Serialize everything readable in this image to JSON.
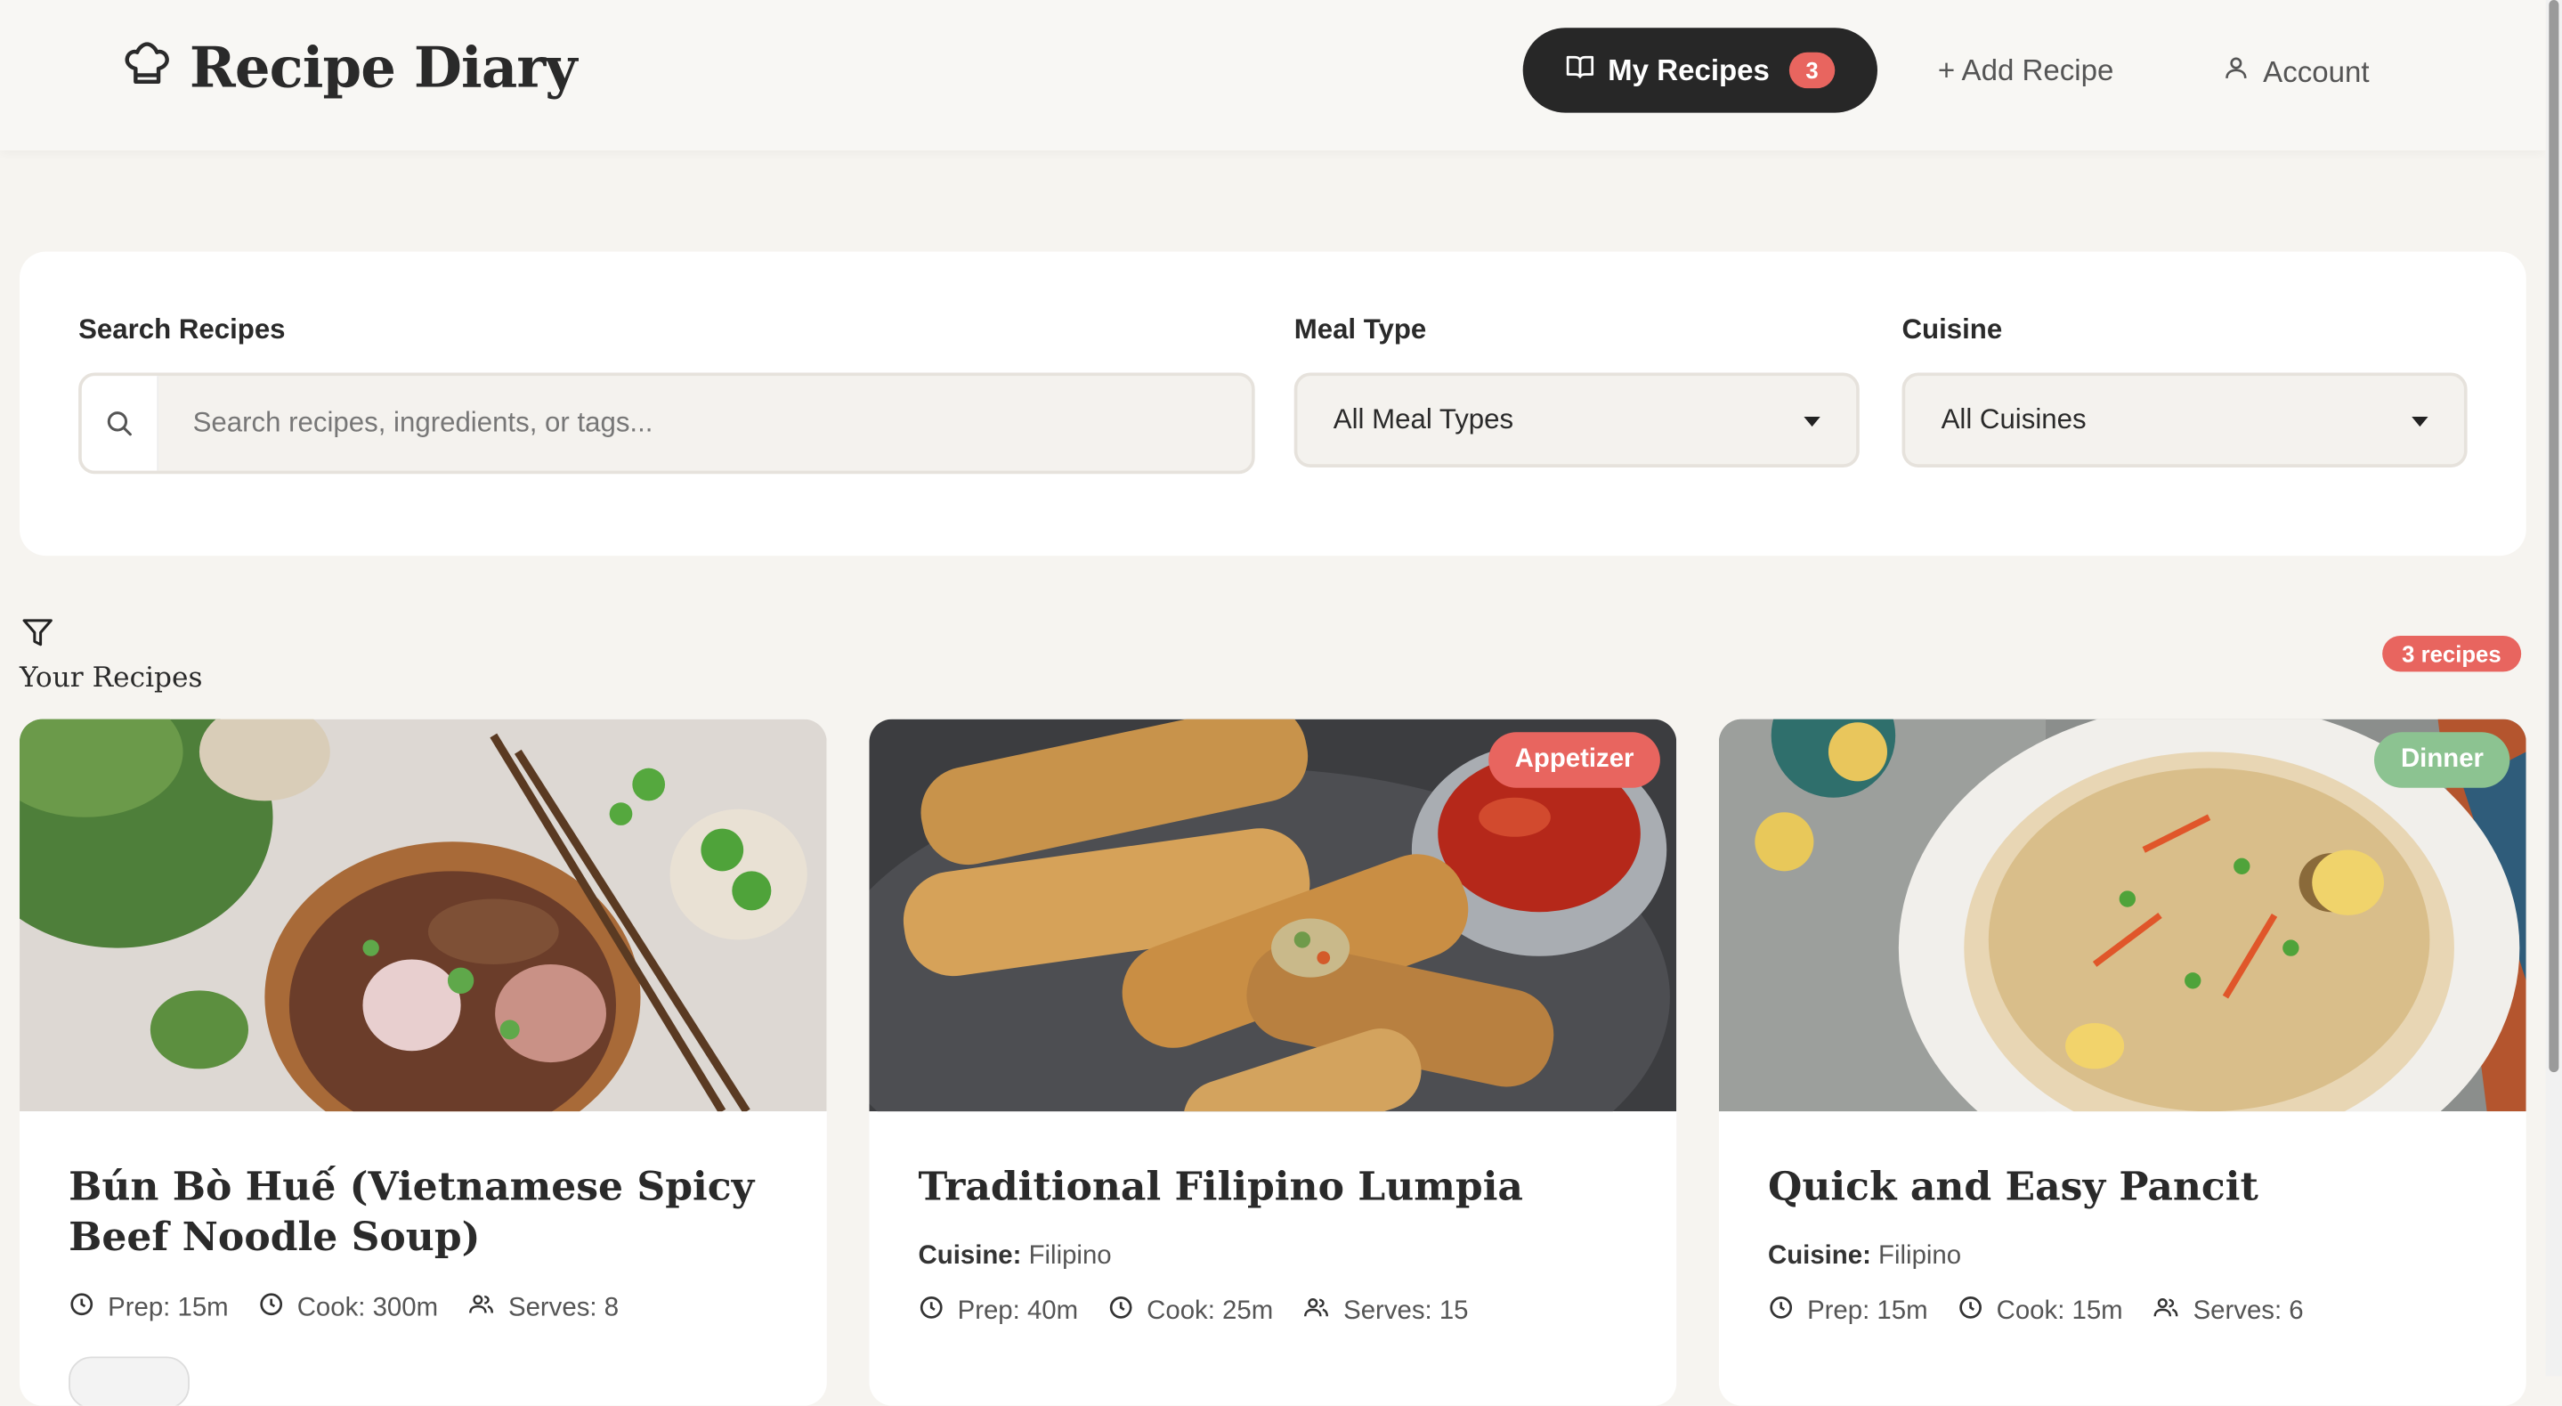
{
  "header": {
    "app_title": "Recipe Diary",
    "logo_icon": "chef-hat-icon",
    "nav": {
      "my_recipes": "My Recipes",
      "my_recipes_count": "3",
      "add_recipe": "+ Add Recipe",
      "account": "Account"
    }
  },
  "filters": {
    "search_label": "Search Recipes",
    "search_placeholder": "Search recipes, ingredients, or tags...",
    "meal_type_label": "Meal Type",
    "meal_type_value": "All Meal Types",
    "cuisine_label": "Cuisine",
    "cuisine_value": "All Cuisines"
  },
  "section": {
    "title": "Your Recipes",
    "count": "3 recipes"
  },
  "colors": {
    "accent": "#e8655f",
    "dark": "#272727",
    "appetizer": "#e8655f",
    "dinner": "#8cc391"
  },
  "recipes": [
    {
      "title": "Bún Bò Huế (Vietnamese Spicy Beef Noodle Soup)",
      "tag": "",
      "cuisine_label": "",
      "cuisine": "",
      "prep": "Prep: 15m",
      "cook": "Cook: 300m",
      "serves": "Serves: 8"
    },
    {
      "title": "Traditional Filipino Lumpia",
      "tag": "Appetizer",
      "cuisine_label": "Cuisine:",
      "cuisine": "Filipino",
      "prep": "Prep: 40m",
      "cook": "Cook: 25m",
      "serves": "Serves: 15"
    },
    {
      "title": "Quick and Easy Pancit",
      "tag": "Dinner",
      "cuisine_label": "Cuisine:",
      "cuisine": "Filipino",
      "prep": "Prep: 15m",
      "cook": "Cook: 15m",
      "serves": "Serves: 6"
    }
  ]
}
